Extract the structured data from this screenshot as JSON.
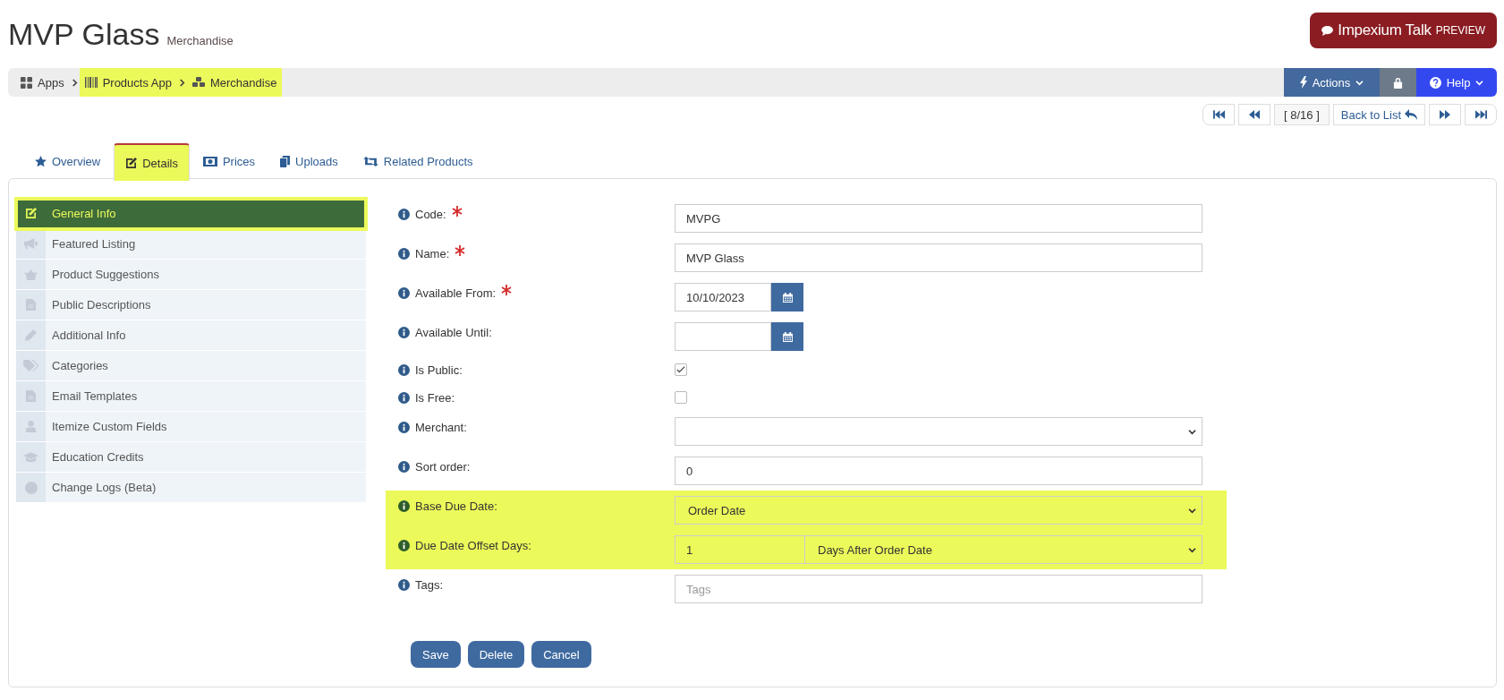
{
  "page_header": {
    "title": "MVP Glass",
    "subtitle": "Merchandise"
  },
  "talk_button": {
    "label": "Impexium Talk",
    "badge": "PREVIEW"
  },
  "breadcrumb": [
    {
      "label": "Apps",
      "highlighted": false
    },
    {
      "label": "Products App",
      "highlighted": true
    },
    {
      "label": "Merchandise",
      "highlighted": true
    }
  ],
  "toolbar": {
    "actions": "Actions",
    "help": "Help"
  },
  "pager": {
    "position": "[ 8/16 ]",
    "back": "Back to List"
  },
  "tabs": [
    {
      "label": "Overview",
      "selected": false,
      "highlighted": false
    },
    {
      "label": "Details",
      "selected": true,
      "highlighted": true
    },
    {
      "label": "Prices",
      "selected": false,
      "highlighted": false
    },
    {
      "label": "Uploads",
      "selected": false,
      "highlighted": false
    },
    {
      "label": "Related Products",
      "selected": false,
      "highlighted": false
    }
  ],
  "sidebar": {
    "items": [
      {
        "label": "General Info",
        "selected": true,
        "highlighted": true
      },
      {
        "label": "Featured Listing",
        "selected": false,
        "highlighted": false
      },
      {
        "label": "Product Suggestions",
        "selected": false,
        "highlighted": false
      },
      {
        "label": "Public Descriptions",
        "selected": false,
        "highlighted": false
      },
      {
        "label": "Additional Info",
        "selected": false,
        "highlighted": false
      },
      {
        "label": "Categories",
        "selected": false,
        "highlighted": false
      },
      {
        "label": "Email Templates",
        "selected": false,
        "highlighted": false
      },
      {
        "label": "Itemize Custom Fields",
        "selected": false,
        "highlighted": false
      },
      {
        "label": "Education Credits",
        "selected": false,
        "highlighted": false
      },
      {
        "label": "Change Logs (Beta)",
        "selected": false,
        "highlighted": false
      }
    ]
  },
  "form": {
    "fields": [
      {
        "kind": "text",
        "label": "Code:",
        "required": true,
        "value": "MVPG",
        "highlighted": false
      },
      {
        "kind": "text",
        "label": "Name:",
        "required": true,
        "value": "MVP Glass",
        "highlighted": false
      },
      {
        "kind": "date",
        "label": "Available From:",
        "required": true,
        "value": "10/10/2023",
        "highlighted": false
      },
      {
        "kind": "date",
        "label": "Available Until:",
        "required": false,
        "highlighted": false
      },
      {
        "kind": "checkbox",
        "label": "Is Public:",
        "required": false,
        "checked": true,
        "highlighted": false
      },
      {
        "kind": "checkbox",
        "label": "Is Free:",
        "required": false,
        "checked": false,
        "highlighted": false
      },
      {
        "kind": "select",
        "label": "Merchant:",
        "required": false,
        "highlighted": false
      },
      {
        "kind": "text",
        "label": "Sort order:",
        "required": false,
        "value": "0",
        "highlighted": false
      },
      {
        "kind": "select",
        "label": "Base Due Date:",
        "required": false,
        "value": "Order Date",
        "highlighted": true
      },
      {
        "kind": "offset",
        "label": "Due Date Offset Days:",
        "required": false,
        "value": "1",
        "option": "Days After Order Date",
        "highlighted": true
      },
      {
        "kind": "text",
        "label": "Tags:",
        "required": false,
        "placeholder": "Tags",
        "highlighted": false
      }
    ],
    "buttons": [
      "Save",
      "Delete",
      "Cancel"
    ]
  }
}
